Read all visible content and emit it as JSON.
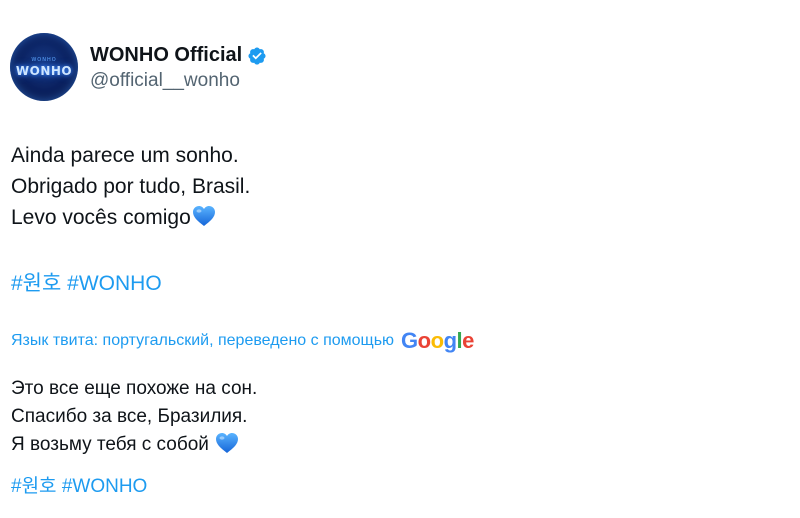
{
  "author": {
    "display_name": "WONHO Official",
    "handle": "@official__wonho",
    "avatar_text": "WONHO",
    "avatar_small_text": "WONHO",
    "verified": true
  },
  "tweet": {
    "lines": [
      "Ainda parece um sonho.",
      "Obrigado por tudo, Brasil.",
      "Levo vocês comigo"
    ],
    "hashtags": [
      "#원호",
      "#WONHO"
    ]
  },
  "translation": {
    "label": "Язык твита: португальский, переведено с помощью",
    "provider_letters": [
      "G",
      "o",
      "o",
      "g",
      "l",
      "e"
    ],
    "lines": [
      "Это все еще похоже на сон.",
      "Спасибо за все, Бразилия.",
      "Я возьму тебя с собой"
    ],
    "hashtags": [
      "#원호",
      "#WONHO"
    ]
  },
  "colors": {
    "link": "#1d9bf0",
    "text": "#0f1419",
    "secondary_text": "#536471",
    "verified_badge": "#1d9bf0",
    "heart": "#1d8cf0"
  },
  "icons": {
    "verified": "verified-badge-icon",
    "heart": "blue-heart-emoji"
  }
}
